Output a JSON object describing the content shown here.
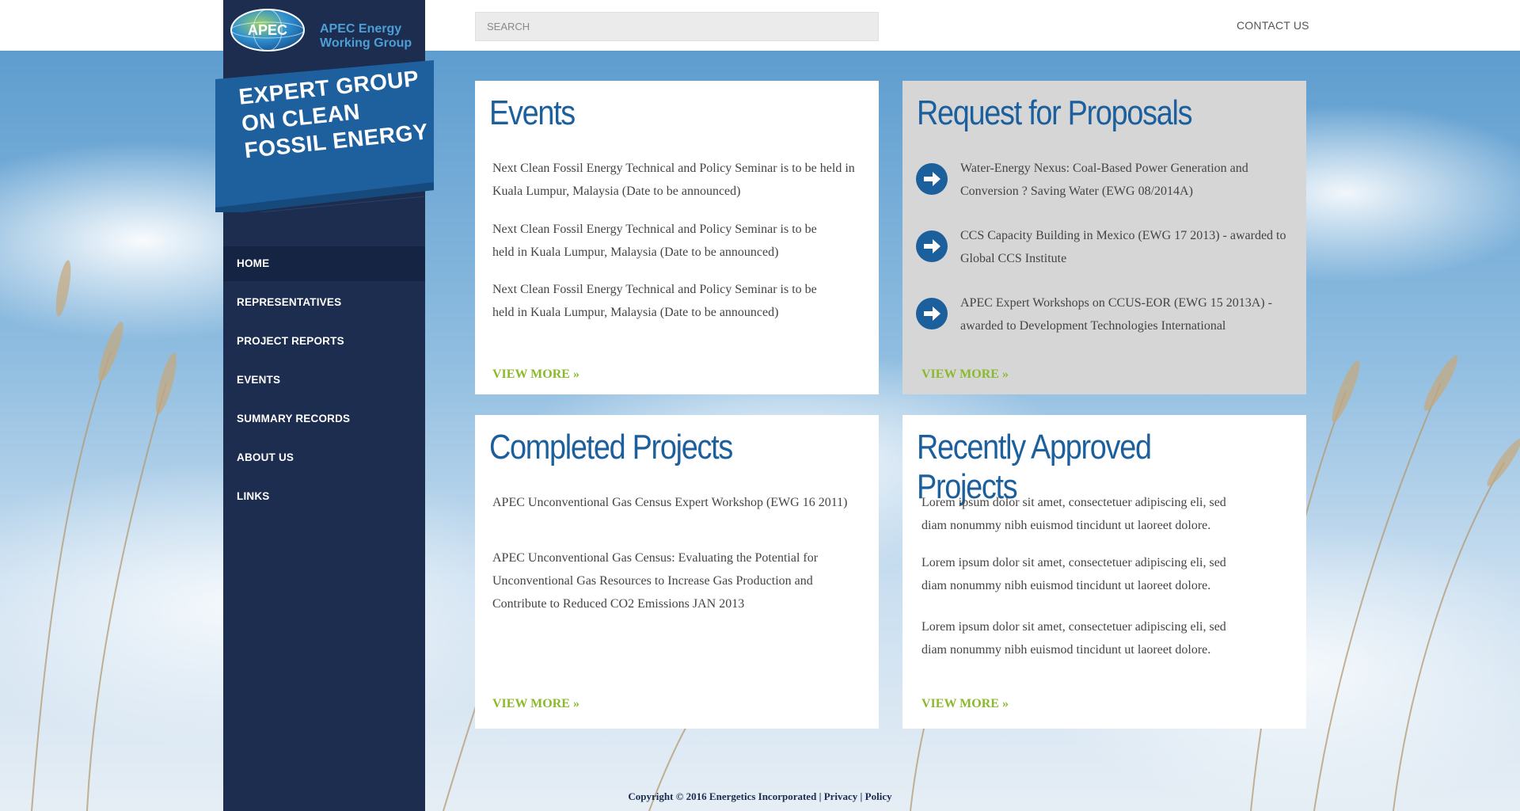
{
  "header": {
    "logo_mark": "APEC",
    "logo_line1": "APEC Energy",
    "logo_line2": "Working Group",
    "search_placeholder": "SEARCH",
    "contact_label": "CONTACT US"
  },
  "banner": {
    "line1": "EXPERT GROUP",
    "line2": "ON CLEAN",
    "line3": "FOSSIL ENERGY"
  },
  "sidebar": {
    "items": [
      {
        "label": "HOME",
        "active": true
      },
      {
        "label": "REPRESENTATIVES"
      },
      {
        "label": "PROJECT REPORTS"
      },
      {
        "label": "EVENTS"
      },
      {
        "label": "SUMMARY RECORDS"
      },
      {
        "label": "ABOUT US"
      },
      {
        "label": "LINKS"
      }
    ]
  },
  "events": {
    "title": "Events",
    "items": [
      "Next Clean Fossil Energy Technical and Policy Seminar is to be held in Kuala Lumpur, Malaysia (Date to be announced)",
      "Next Clean Fossil Energy Technical and Policy Seminar is to be held in Kuala Lumpur, Malaysia (Date to be announced)",
      "Next Clean Fossil Energy Technical and Policy Seminar is to be held in Kuala Lumpur, Malaysia (Date to be announced)"
    ],
    "view_more": "VIEW MORE »"
  },
  "proposals": {
    "title": "Request for Proposals",
    "items": [
      "Water-Energy Nexus: Coal-Based Power Generation and Conversion ? Saving Water (EWG 08/2014A)",
      "CCS Capacity Building in Mexico (EWG 17 2013) - awarded to Global CCS Institute",
      "APEC Expert Workshops on CCUS-EOR (EWG 15 2013A) - awarded to Development Technologies International"
    ],
    "view_more": "VIEW MORE »"
  },
  "completed": {
    "title": "Completed Projects",
    "items": [
      "APEC Unconventional Gas Census Expert Workshop (EWG 16 2011)",
      "APEC Unconventional Gas Census: Evaluating the Potential for Unconventional Gas Resources to Increase Gas Production and Contribute to Reduced CO2 Emissions JAN 2013"
    ],
    "view_more": "VIEW MORE »"
  },
  "approved": {
    "title": "Recently Approved Projects",
    "items": [
      "Lorem ipsum dolor sit amet, consectetuer adipiscing eli, sed diam nonummy nibh euismod tincidunt ut laoreet dolore.",
      "Lorem ipsum dolor sit amet, consectetuer adipiscing eli, sed diam nonummy nibh euismod tincidunt ut laoreet dolore.",
      "Lorem ipsum dolor sit amet, consectetuer adipiscing eli, sed diam nonummy nibh euismod tincidunt ut laoreet dolore."
    ],
    "view_more": "VIEW MORE »"
  },
  "footer": {
    "copyright": "Copyright © 2016 Energetics Incorporated",
    "sep1": " | ",
    "privacy": "Privacy",
    "sep2": " | ",
    "policy": "Policy"
  },
  "colors": {
    "navy": "#1c2d4f",
    "title_blue": "#1b5f9c",
    "link_green": "#8aba2c",
    "banner_blue": "#1e5f9e"
  }
}
